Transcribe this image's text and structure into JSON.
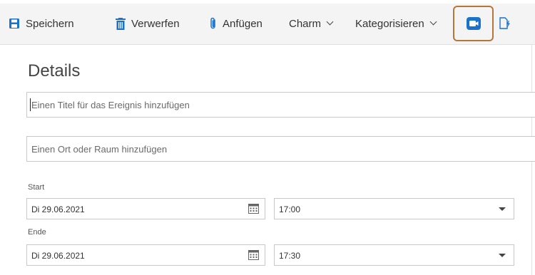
{
  "toolbar": {
    "save": "Speichern",
    "discard": "Verwerfen",
    "attach": "Anfügen",
    "charm": "Charm",
    "categorize": "Kategorisieren",
    "teams_icon": "teams-meeting-icon",
    "notes_icon": "meeting-notes-icon"
  },
  "colors": {
    "accent": "#0f6cbd",
    "highlight_border": "#b5763a"
  },
  "form": {
    "heading": "Details",
    "title_placeholder": "Einen Titel für das Ereignis hinzufügen",
    "location_placeholder": "Einen Ort oder Raum hinzufügen",
    "start": {
      "label": "Start",
      "date": "Di 29.06.2021",
      "time": "17:00"
    },
    "end": {
      "label": "Ende",
      "date": "Di 29.06.2021",
      "time": "17:30"
    }
  }
}
